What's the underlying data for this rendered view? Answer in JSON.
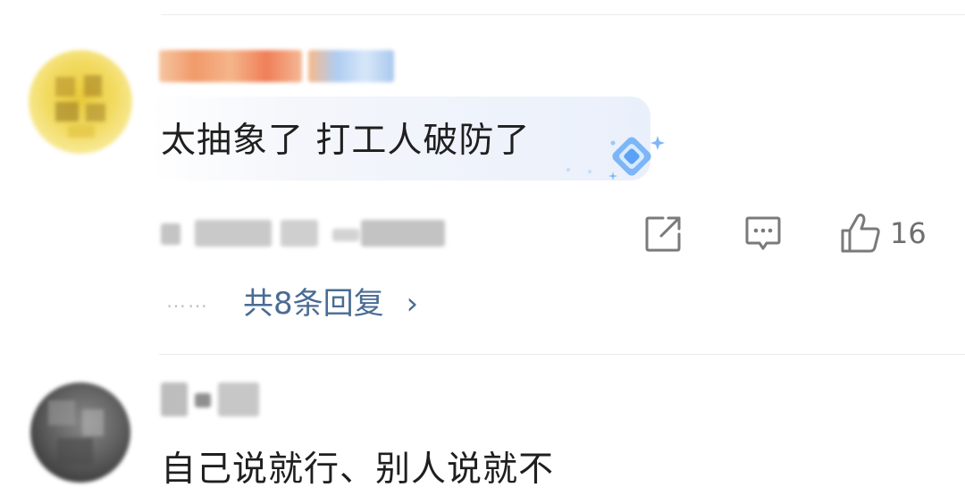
{
  "comments": [
    {
      "text": "太抽象了  打工人破防了",
      "like_count": "16",
      "replies_label": "共8条回复",
      "replies_arrow": "›",
      "dots": "……"
    },
    {
      "text": "自己说就行、别人说就不"
    }
  ],
  "colors": {
    "reply_link": "#4a6c93",
    "icon_gray": "#7a7a7a",
    "divider": "#ececec",
    "badge_blue": "#5aa2f5"
  },
  "icons": [
    "share-icon",
    "comment-icon",
    "thumbs-up-icon",
    "diamond-badge-icon"
  ]
}
